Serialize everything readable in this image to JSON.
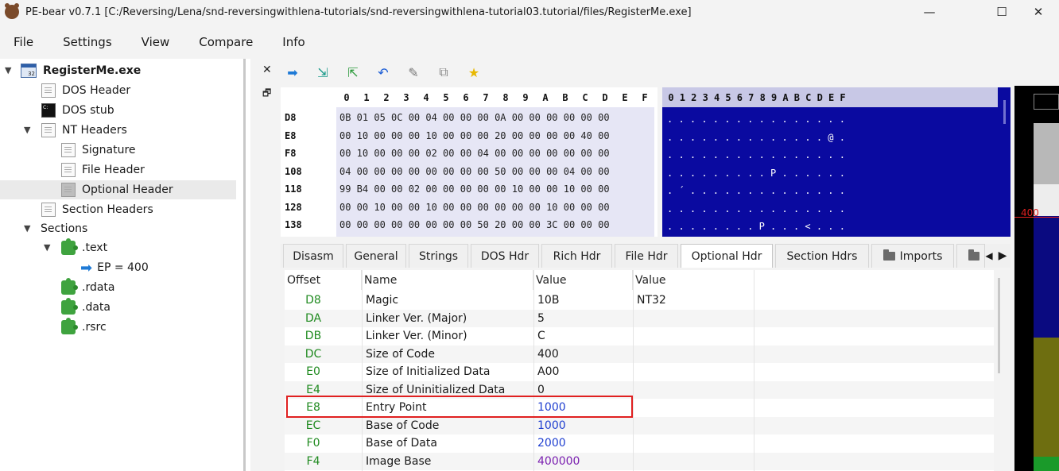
{
  "window": {
    "title": "PE-bear v0.7.1 [C:/Reversing/Lena/snd-reversingwithlena-tutorials/snd-reversingwithlena-tutorial03.tutorial/files/RegisterMe.exe]",
    "minimize": "—",
    "maximize": "☐",
    "close": "✕"
  },
  "menu": [
    "File",
    "Settings",
    "View",
    "Compare",
    "Info"
  ],
  "tree": {
    "root": "RegisterMe.exe",
    "dos_header": "DOS Header",
    "dos_stub": "DOS stub",
    "nt_headers": "NT Headers",
    "signature": "Signature",
    "file_header": "File Header",
    "optional_header": "Optional Header",
    "section_headers": "Section Headers",
    "sections": "Sections",
    "text": ".text",
    "ep": "EP = 400",
    "rdata": ".rdata",
    "data": ".data",
    "rsrc": ".rsrc",
    "selected": "Optional Header"
  },
  "dock": {
    "close": "✕",
    "float": "🗗"
  },
  "toolbar_icons": [
    "arrow-right-icon",
    "import-icon",
    "export-icon",
    "undo-icon",
    "pin-icon",
    "copy-icon",
    "star-icon"
  ],
  "hex": {
    "columns": [
      "0",
      "1",
      "2",
      "3",
      "4",
      "5",
      "6",
      "7",
      "8",
      "9",
      "A",
      "B",
      "C",
      "D",
      "E",
      "F"
    ],
    "rows": [
      {
        "addr": "D8",
        "bytes": "0B 01 05 0C 00 04 00 00 00 0A 00 00 00 00 00 00",
        "ascii": ". . . . . . . . . . . . . . . ."
      },
      {
        "addr": "E8",
        "bytes": "00 10 00 00 00 10 00 00 00 20 00 00 00 00 40 00",
        "ascii": ". . . . . . . . . . . . . . @ ."
      },
      {
        "addr": "F8",
        "bytes": "00 10 00 00 00 02 00 00 04 00 00 00 00 00 00 00",
        "ascii": ". . . . . . . . . . . . . . . ."
      },
      {
        "addr": "108",
        "bytes": "04 00 00 00 00 00 00 00 00 50 00 00 00 04 00 00",
        "ascii": ". . . . . . . . . P . . . . . ."
      },
      {
        "addr": "118",
        "bytes": "99 B4 00 00 02 00 00 00 00 00 10 00 00 10 00 00",
        "ascii": ". ´ . . . . . . . . . . . . . ."
      },
      {
        "addr": "128",
        "bytes": "00 00 10 00 00 10 00 00 00 00 00 00 10 00 00 00",
        "ascii": ". . . . . . . . . . . . . . . ."
      },
      {
        "addr": "138",
        "bytes": "00 00 00 00 00 00 00 00 50 20 00 00 3C 00 00 00",
        "ascii": ". . . . . . . . P . . . < . . ."
      }
    ]
  },
  "tabs": [
    "Disasm",
    "General",
    "Strings",
    "DOS Hdr",
    "Rich Hdr",
    "File Hdr",
    "Optional Hdr",
    "Section Hdrs",
    "Imports",
    ""
  ],
  "active_tab": "Optional Hdr",
  "table": {
    "headers": [
      "Offset",
      "Name",
      "Value",
      "Value"
    ],
    "rows": [
      {
        "offset": "D8",
        "name": "Magic",
        "value": "10B",
        "value2": "NT32",
        "color": "#1a1a1a"
      },
      {
        "offset": "DA",
        "name": "Linker Ver. (Major)",
        "value": "5",
        "value2": "",
        "color": "#1a1a1a"
      },
      {
        "offset": "DB",
        "name": "Linker Ver. (Minor)",
        "value": "C",
        "value2": "",
        "color": "#1a1a1a"
      },
      {
        "offset": "DC",
        "name": "Size of Code",
        "value": "400",
        "value2": "",
        "color": "#1a1a1a"
      },
      {
        "offset": "E0",
        "name": "Size of Initialized Data",
        "value": "A00",
        "value2": "",
        "color": "#1a1a1a"
      },
      {
        "offset": "E4",
        "name": "Size of Uninitialized Data",
        "value": "0",
        "value2": "",
        "color": "#1a1a1a"
      },
      {
        "offset": "E8",
        "name": "Entry Point",
        "value": "1000",
        "value2": "",
        "color": "#1f3fd0"
      },
      {
        "offset": "EC",
        "name": "Base of Code",
        "value": "1000",
        "value2": "",
        "color": "#1f3fd0"
      },
      {
        "offset": "F0",
        "name": "Base of Data",
        "value": "2000",
        "value2": "",
        "color": "#1f3fd0"
      },
      {
        "offset": "F4",
        "name": "Image Base",
        "value": "400000",
        "value2": "",
        "color": "#7a1fb0"
      }
    ]
  },
  "overview": {
    "marker_label": "400"
  }
}
